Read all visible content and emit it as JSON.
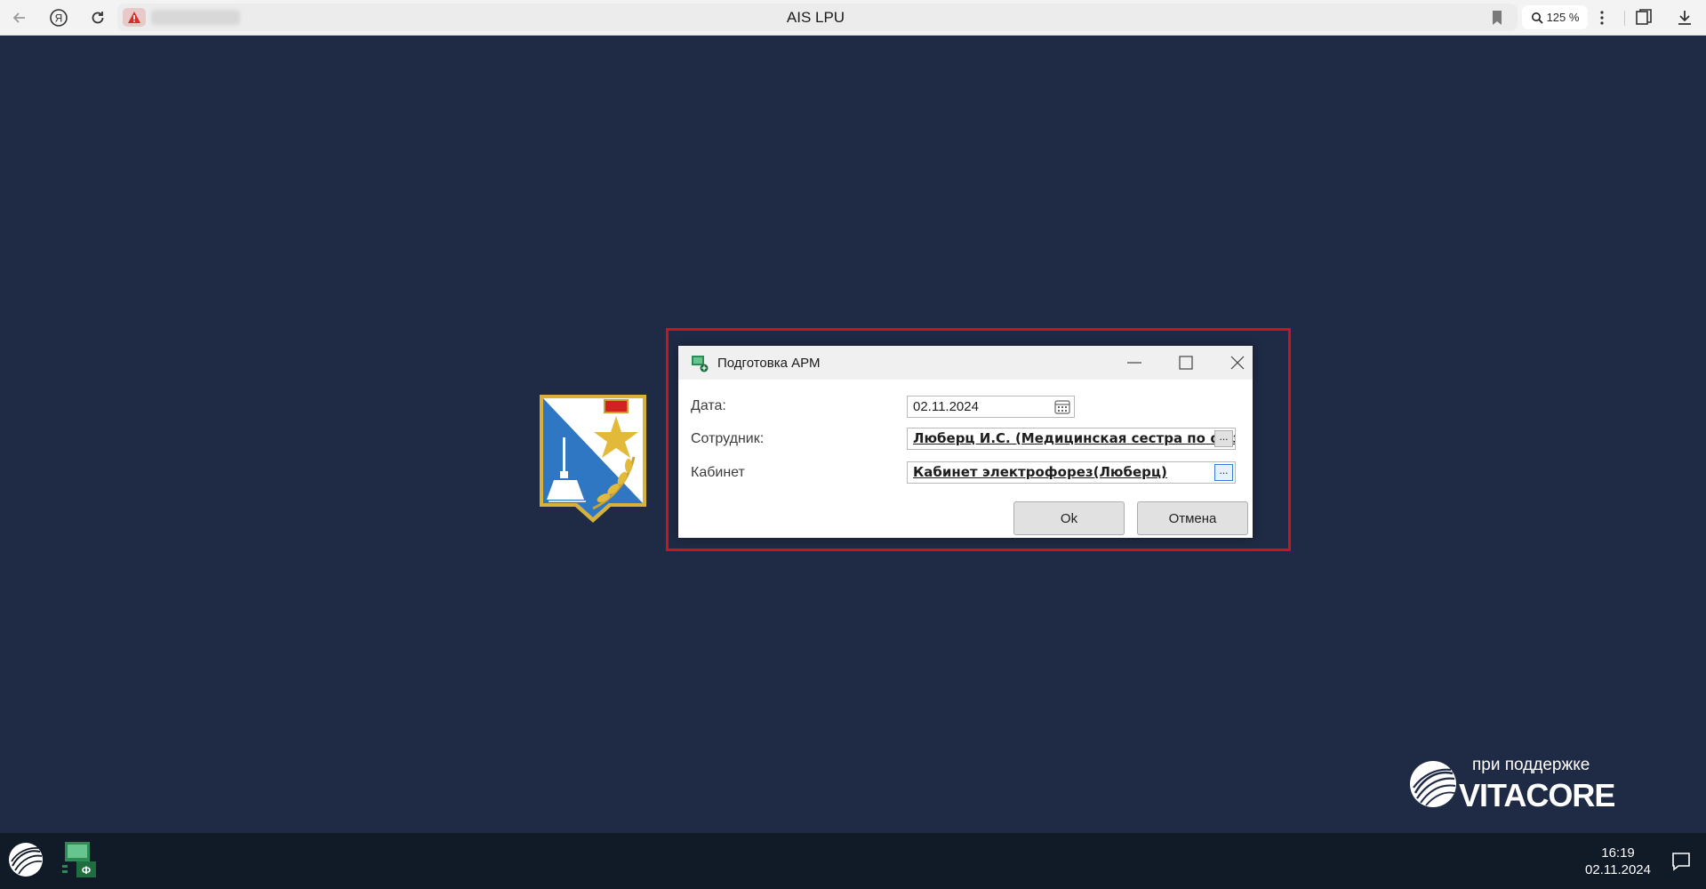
{
  "browser": {
    "tab_title": "AIS LPU",
    "zoom": "125 %",
    "icons": [
      "back-arrow-icon",
      "yandex-icon",
      "reload-icon",
      "security-alert-icon",
      "bookmark-icon",
      "zoom-icon",
      "menu-icon",
      "collections-icon",
      "download-icon"
    ]
  },
  "dialog": {
    "title": "Подготовка АРМ",
    "fields": {
      "date": {
        "label": "Дата:",
        "value": "02.11.2024"
      },
      "employee": {
        "label": "Сотрудник:",
        "value": "Люберц И.С. (Медицинская сестра по физиотерапии)",
        "button": "..."
      },
      "cabinet": {
        "label": "Кабинет",
        "value": "Кабинет электрофорез(Люберц)",
        "button": "..."
      }
    },
    "buttons": {
      "ok": "Ok",
      "cancel": "Отмена"
    }
  },
  "brand": {
    "caption": "при поддержке",
    "name": "VITACORE"
  },
  "taskbar": {
    "time": "16:19",
    "date": "02.11.2024"
  },
  "colors": {
    "background": "#1f2a44",
    "taskbar": "#111a27",
    "highlight": "#c8161d"
  }
}
